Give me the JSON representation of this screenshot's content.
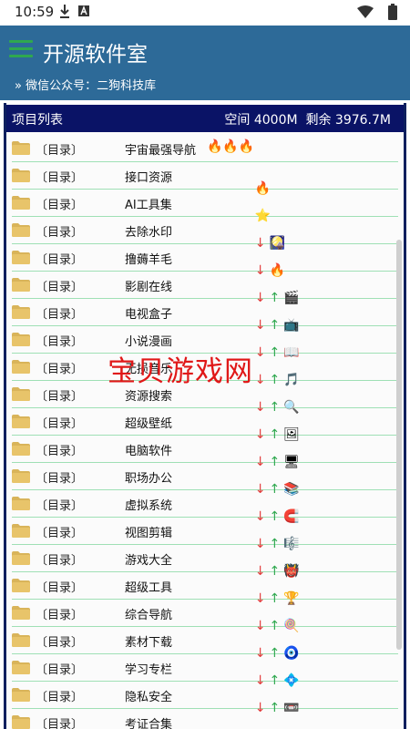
{
  "status": {
    "time": "10:59"
  },
  "header": {
    "title": "开源软件室",
    "subtitle": "» 微信公众号：二狗科技库"
  },
  "list": {
    "title": "项目列表",
    "space": "空间 4000M  剩余 3976.7M"
  },
  "rows": [
    {
      "tag": "〔目录〕",
      "name": "宇宙最强导航",
      "badge": "🔥🔥🔥",
      "down": "",
      "up": "",
      "app": ""
    },
    {
      "tag": "〔目录〕",
      "name": "接口资源",
      "badge": "",
      "down": "",
      "up": "",
      "app": "🔥"
    },
    {
      "tag": "〔目录〕",
      "name": "AI工具集",
      "badge": "",
      "down": "",
      "up": "",
      "app": "⭐"
    },
    {
      "tag": "〔目录〕",
      "name": "去除水印",
      "badge": "",
      "down": "↓",
      "up": "",
      "app": "🎑"
    },
    {
      "tag": "〔目录〕",
      "name": "撸薅羊毛",
      "badge": "",
      "down": "↓",
      "up": "",
      "app": "🔥"
    },
    {
      "tag": "〔目录〕",
      "name": "影剧在线",
      "badge": "",
      "down": "↓",
      "up": "↑",
      "app": "🎬"
    },
    {
      "tag": "〔目录〕",
      "name": "电视盒子",
      "badge": "",
      "down": "↓",
      "up": "↑",
      "app": "📺"
    },
    {
      "tag": "〔目录〕",
      "name": "小说漫画",
      "badge": "",
      "down": "↓",
      "up": "↑",
      "app": "📖"
    },
    {
      "tag": "〔目录〕",
      "name": "无损音乐",
      "badge": "",
      "down": "↓",
      "up": "↑",
      "app": "🎵"
    },
    {
      "tag": "〔目录〕",
      "name": "资源搜索",
      "badge": "",
      "down": "↓",
      "up": "↑",
      "app": "🔍"
    },
    {
      "tag": "〔目录〕",
      "name": "超级壁纸",
      "badge": "",
      "down": "↓",
      "up": "↑",
      "app": "🖼"
    },
    {
      "tag": "〔目录〕",
      "name": "电脑软件",
      "badge": "",
      "down": "↓",
      "up": "↑",
      "app": "🖥"
    },
    {
      "tag": "〔目录〕",
      "name": "职场办公",
      "badge": "",
      "down": "↓",
      "up": "↑",
      "app": "📚"
    },
    {
      "tag": "〔目录〕",
      "name": "虚拟系统",
      "badge": "",
      "down": "↓",
      "up": "↑",
      "app": "🧲"
    },
    {
      "tag": "〔目录〕",
      "name": "视图剪辑",
      "badge": "",
      "down": "↓",
      "up": "↑",
      "app": "🎼"
    },
    {
      "tag": "〔目录〕",
      "name": "游戏大全",
      "badge": "",
      "down": "↓",
      "up": "↑",
      "app": "👹"
    },
    {
      "tag": "〔目录〕",
      "name": "超级工具",
      "badge": "",
      "down": "↓",
      "up": "↑",
      "app": "🏆"
    },
    {
      "tag": "〔目录〕",
      "name": "综合导航",
      "badge": "",
      "down": "↓",
      "up": "↑",
      "app": "🍭"
    },
    {
      "tag": "〔目录〕",
      "name": "素材下载",
      "badge": "",
      "down": "↓",
      "up": "↑",
      "app": "🧿"
    },
    {
      "tag": "〔目录〕",
      "name": "学习专栏",
      "badge": "",
      "down": "↓",
      "up": "↑",
      "app": "💠"
    },
    {
      "tag": "〔目录〕",
      "name": "隐私安全",
      "badge": "",
      "down": "↓",
      "up": "↑",
      "app": "📼"
    },
    {
      "tag": "〔目录〕",
      "name": "考证合集",
      "badge": "",
      "down": "↓",
      "up": "↑",
      "app": ""
    }
  ],
  "watermark": "宝贝游戏网",
  "colors": {
    "header_bg": "#2d6a98",
    "list_header_bg": "#0a1366",
    "row_divider": "#9fe0b5",
    "watermark": "#e01818"
  }
}
